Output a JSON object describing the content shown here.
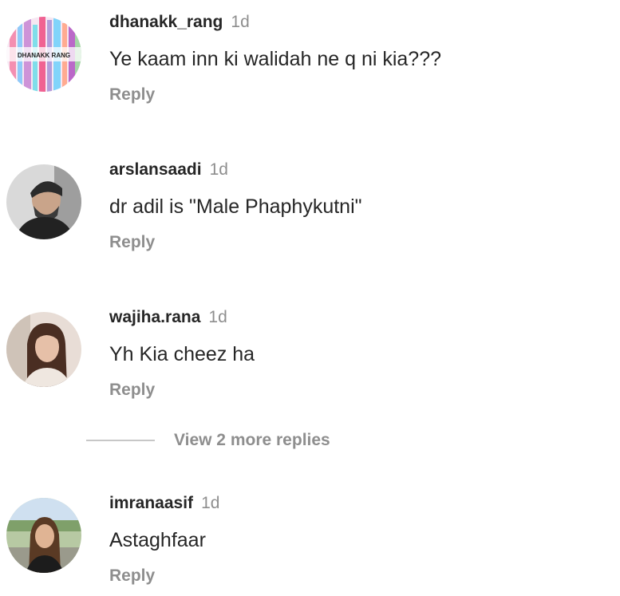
{
  "comments": [
    {
      "username": "dhanakk_rang",
      "time": "1d",
      "text": "Ye kaam inn ki walidah ne q ni kia???",
      "reply_label": "Reply",
      "avatar_text": "DHANAKK RANG"
    },
    {
      "username": "arslansaadi",
      "time": "1d",
      "text": "dr adil is \"Male Phaphykutni\"",
      "reply_label": "Reply"
    },
    {
      "username": "wajiha.rana",
      "time": "1d",
      "text": "Yh Kia cheez ha",
      "reply_label": "Reply"
    },
    {
      "username": "imranaasif",
      "time": "1d",
      "text": "Astaghfaar",
      "reply_label": "Reply"
    }
  ],
  "view_more_replies": "View 2 more replies",
  "colors": {
    "username": "#262626",
    "secondary": "#8e8e8e",
    "divider": "#c7c7c7"
  }
}
